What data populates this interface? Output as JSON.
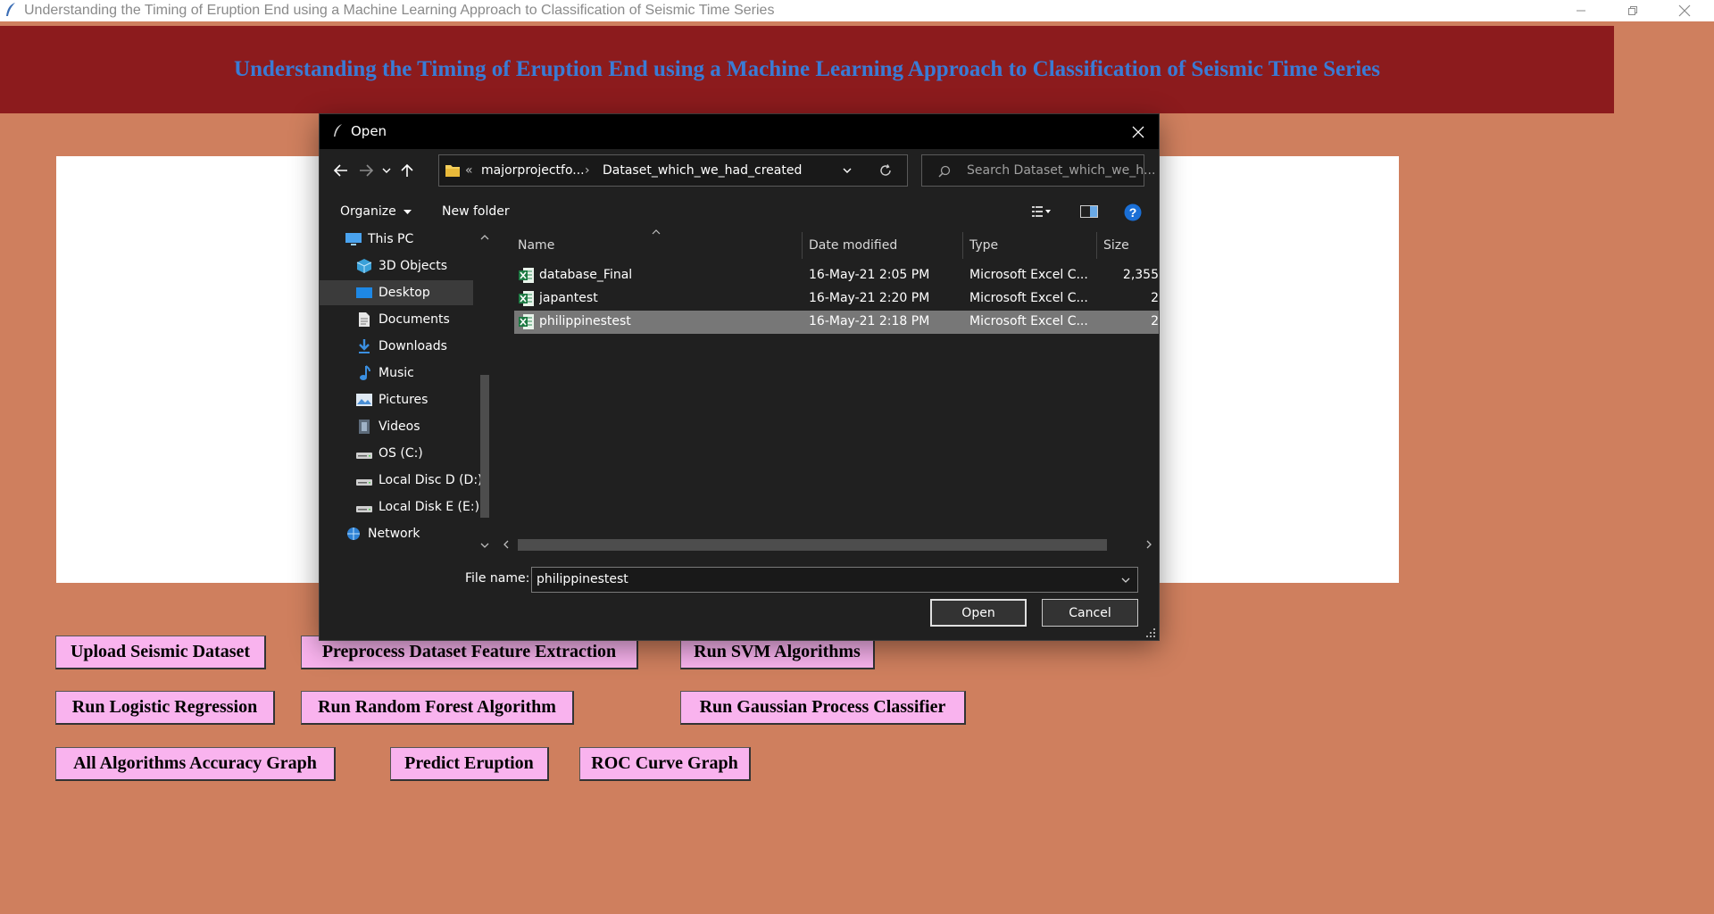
{
  "window": {
    "title": "Understanding the Timing of Eruption End using a Machine Learning Approach to Classification of Seismic Time Series"
  },
  "header": {
    "title": "Understanding the Timing of Eruption End using a Machine Learning Approach to Classification of Seismic Time Series"
  },
  "colors": {
    "background": "#cf7f5e",
    "header_band": "#8c1b1d",
    "header_text": "#3a7bd5",
    "button": "#f9b3ee"
  },
  "buttons": {
    "upload": "Upload Seismic Dataset",
    "preprocess": "Preprocess Dataset Feature Extraction",
    "svm": "Run SVM Algorithms",
    "logistic": "Run Logistic Regression",
    "random_forest": "Run Random Forest Algorithm",
    "gaussian": "Run Gaussian Process Classifier",
    "accuracy_graph": "All Algorithms Accuracy Graph",
    "predict": "Predict Eruption",
    "roc": "ROC Curve Graph"
  },
  "dialog": {
    "title": "Open",
    "address": {
      "overflow": "«",
      "parent": "majorprojectfo...",
      "separator": "›",
      "current": "Dataset_which_we_had_created"
    },
    "search_placeholder": "Search Dataset_which_we_h...",
    "toolbar": {
      "organize": "Organize",
      "new_folder": "New folder"
    },
    "nav": [
      {
        "label": "This PC",
        "icon": "pc-icon"
      },
      {
        "label": "3D Objects",
        "icon": "cube-icon"
      },
      {
        "label": "Desktop",
        "icon": "desktop-icon",
        "selected": true
      },
      {
        "label": "Documents",
        "icon": "document-icon"
      },
      {
        "label": "Downloads",
        "icon": "download-icon"
      },
      {
        "label": "Music",
        "icon": "music-icon"
      },
      {
        "label": "Pictures",
        "icon": "picture-icon"
      },
      {
        "label": "Videos",
        "icon": "video-icon"
      },
      {
        "label": "OS (C:)",
        "icon": "drive-icon"
      },
      {
        "label": "Local Disc D (D:)",
        "icon": "drive-icon"
      },
      {
        "label": "Local Disk E (E:)",
        "icon": "drive-icon"
      },
      {
        "label": "Network",
        "icon": "network-icon"
      }
    ],
    "columns": {
      "name": "Name",
      "date": "Date modified",
      "type": "Type",
      "size": "Size"
    },
    "files": [
      {
        "name": "database_Final",
        "date": "16-May-21 2:05 PM",
        "type": "Microsoft Excel C...",
        "size": "2,355"
      },
      {
        "name": "japantest",
        "date": "16-May-21 2:20 PM",
        "type": "Microsoft Excel C...",
        "size": "2"
      },
      {
        "name": "philippinestest",
        "date": "16-May-21 2:18 PM",
        "type": "Microsoft Excel C...",
        "size": "2",
        "selected": true
      }
    ],
    "file_name_label": "File name:",
    "file_name_value": "philippinestest",
    "open_button": "Open",
    "cancel_button": "Cancel"
  }
}
